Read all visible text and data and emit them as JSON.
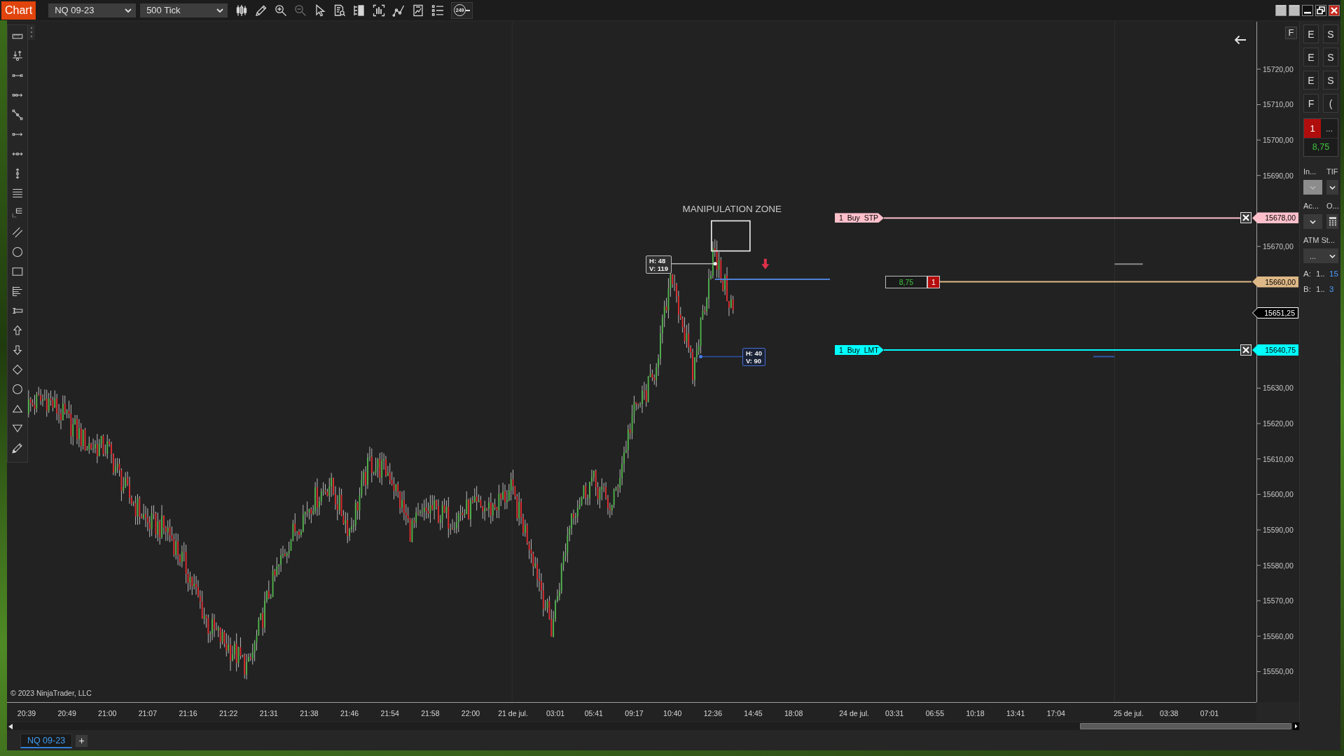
{
  "topbar": {
    "title": "Chart",
    "instrument": "NQ 09-23",
    "interval": "500 Tick",
    "zoom_out_disabled": true,
    "bar_counter": "249"
  },
  "chart": {
    "annotation": "MANIPULATION ZONE",
    "swings": [
      {
        "kind": "high",
        "lines": [
          "H: 48",
          "V: 119"
        ]
      },
      {
        "kind": "low",
        "lines": [
          "H: 40",
          "V: 90"
        ]
      }
    ],
    "orders": [
      {
        "quantity": "1",
        "label": "Buy STP",
        "price": "15678,00",
        "color": "#ffc0cb"
      },
      {
        "quantity": "1",
        "label": "Buy LMT",
        "price": "15640,75",
        "color": "#00ffff"
      }
    ],
    "position": {
      "pnl": "8,75",
      "quantity": "1",
      "price": "15660,00",
      "color": "#deb887"
    },
    "last_price": "15651,25",
    "copyright": "© 2023 NinjaTrader, LLC"
  },
  "price_axis": {
    "button": "F",
    "labels": [
      "15720,00",
      "15710,00",
      "15700,00",
      "15690,00",
      "15670,00",
      "15630,00",
      "15620,00",
      "15610,00",
      "15600,00",
      "15590,00",
      "15580,00",
      "15570,00",
      "15560,00",
      "15550,00"
    ]
  },
  "time_axis": {
    "labels": [
      "20:39",
      "20:49",
      "21:00",
      "21:07",
      "21:16",
      "21:22",
      "21:31",
      "21:38",
      "21:46",
      "21:54",
      "21:58",
      "22:00",
      "21 de jul.",
      "03:01",
      "05:41",
      "09:17",
      "10:40",
      "12:36",
      "14:45",
      "18:08",
      "24 de jul.",
      "03:31",
      "06:55",
      "10:18",
      "13:41",
      "17:04",
      "25 de jul.",
      "03:38",
      "07:01"
    ]
  },
  "chart_trader": {
    "order_buttons": [
      "E",
      "S",
      "E",
      "S",
      "E",
      "S",
      "F",
      "("
    ],
    "quantity": "1",
    "quantity_more": "...",
    "pnl": "8,75",
    "fields": [
      {
        "label": "In...",
        "kind": "dropdown",
        "disabled": true
      },
      {
        "label": "TIF",
        "kind": "dropdown",
        "disabled": false
      },
      {
        "label": "Ac...",
        "kind": "dropdown",
        "disabled": false
      },
      {
        "label": "O...",
        "kind": "calculator",
        "disabled": false
      }
    ],
    "atm_label": "ATM St...",
    "atm_value": "...",
    "accounts": [
      {
        "label": "A:",
        "name": "1..",
        "value": "15"
      },
      {
        "label": "B:",
        "name": "1..",
        "value": "3"
      }
    ]
  },
  "tabs": [
    {
      "label": "NQ 09-23",
      "selected": true
    }
  ],
  "add_tab": "+"
}
